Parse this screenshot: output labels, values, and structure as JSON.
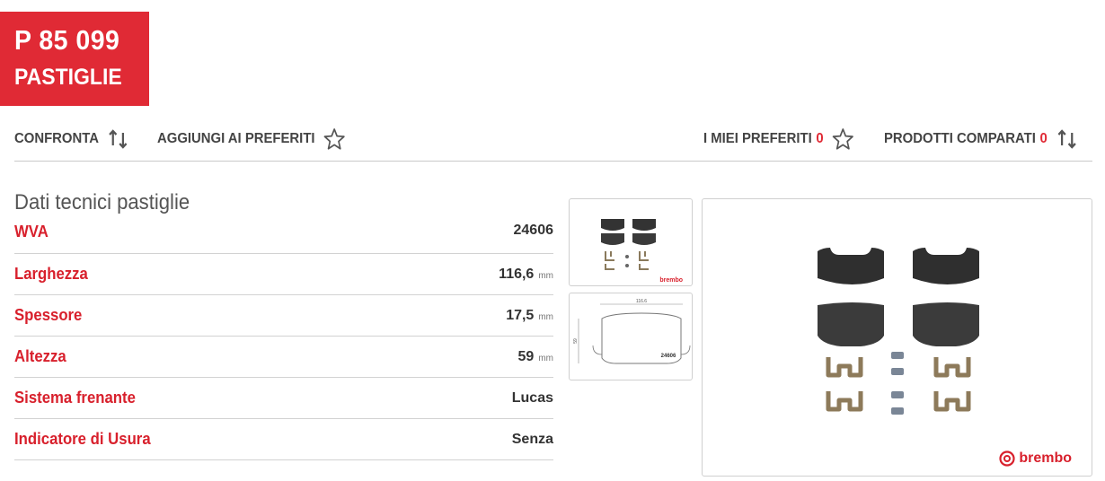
{
  "product": {
    "code": "P 85 099",
    "type": "PASTIGLIE"
  },
  "actions": {
    "compare": "CONFRONTA",
    "add_favorites": "AGGIUNGI AI PREFERITI",
    "my_favorites": "I MIEI PREFERITI",
    "my_favorites_count": "0",
    "compared": "PRODOTTI COMPARATI",
    "compared_count": "0"
  },
  "specs": {
    "title": "Dati tecnici pastiglie",
    "rows": [
      {
        "label": "WVA",
        "value": "24606",
        "unit": ""
      },
      {
        "label": "Larghezza",
        "value": "116,6",
        "unit": "mm"
      },
      {
        "label": "Spessore",
        "value": "17,5",
        "unit": "mm"
      },
      {
        "label": "Altezza",
        "value": "59",
        "unit": "mm"
      },
      {
        "label": "Sistema frenante",
        "value": "Lucas",
        "unit": ""
      },
      {
        "label": "Indicatore di Usura",
        "value": "Senza",
        "unit": ""
      }
    ]
  },
  "images": {
    "brand": "brembo",
    "drawing_width": "116.6",
    "drawing_height": "59",
    "drawing_code": "24606"
  },
  "colors": {
    "accent": "#e02a35",
    "label_red": "#d8202c"
  }
}
